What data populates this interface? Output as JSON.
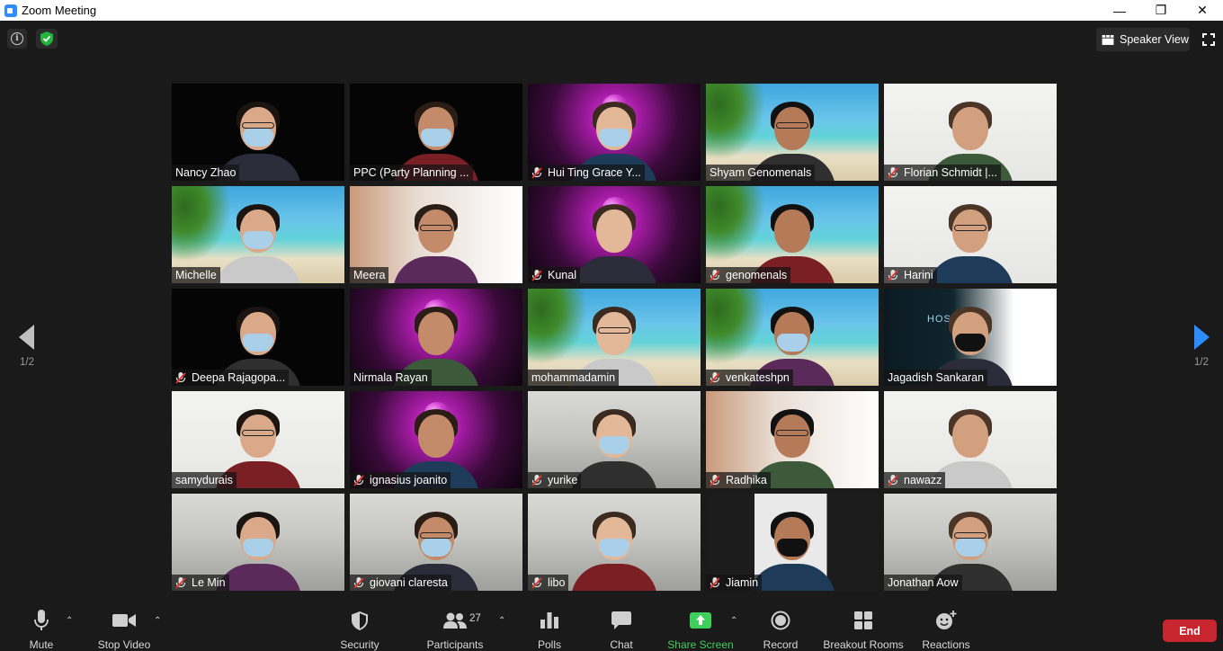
{
  "window": {
    "title": "Zoom Meeting",
    "controls": [
      "—",
      "❐",
      "✕"
    ]
  },
  "top_bar": {
    "info_icon": "i",
    "speaker_view_label": "Speaker View"
  },
  "nav": {
    "left_page": "1/2",
    "right_page": "1/2"
  },
  "participants": [
    {
      "name": "Nancy Zhao",
      "muted": false,
      "bg": "black",
      "mask": true,
      "active": false
    },
    {
      "name": "PPC (Party Planning ...",
      "muted": false,
      "bg": "black",
      "mask": true,
      "active": true
    },
    {
      "name": "Hui Ting Grace Y...",
      "muted": true,
      "bg": "party",
      "mask": true,
      "active": false
    },
    {
      "name": "Shyam Genomenals",
      "muted": false,
      "bg": "beach",
      "mask": false,
      "active": false
    },
    {
      "name": "Florian Schmidt |...",
      "muted": true,
      "bg": "white",
      "mask": false,
      "active": false
    },
    {
      "name": "Michelle",
      "muted": false,
      "bg": "beach",
      "mask": true,
      "active": false
    },
    {
      "name": "Meera",
      "muted": false,
      "bg": "room",
      "mask": false,
      "active": false
    },
    {
      "name": "Kunal",
      "muted": true,
      "bg": "party",
      "mask": false,
      "active": false
    },
    {
      "name": "genomenals",
      "muted": true,
      "bg": "beach",
      "mask": false,
      "active": false
    },
    {
      "name": "Harini",
      "muted": true,
      "bg": "white",
      "mask": false,
      "active": false
    },
    {
      "name": "Deepa Rajagopa...",
      "muted": true,
      "bg": "black",
      "mask": true,
      "active": false
    },
    {
      "name": "Nirmala Rayan",
      "muted": false,
      "bg": "party",
      "mask": false,
      "active": false
    },
    {
      "name": "mohammadamin",
      "muted": false,
      "bg": "beach",
      "mask": false,
      "active": false
    },
    {
      "name": "venkateshpn",
      "muted": true,
      "bg": "beach",
      "mask": true,
      "active": false
    },
    {
      "name": "Jagadish Sankaran",
      "muted": false,
      "bg": "host",
      "mask": true,
      "active": false
    },
    {
      "name": "samydurais",
      "muted": false,
      "bg": "white",
      "mask": false,
      "active": false
    },
    {
      "name": "ignasius joanito",
      "muted": true,
      "bg": "party",
      "mask": false,
      "active": false
    },
    {
      "name": "yurike",
      "muted": true,
      "bg": "office",
      "mask": true,
      "active": false
    },
    {
      "name": "Radhika",
      "muted": true,
      "bg": "room",
      "mask": false,
      "active": false
    },
    {
      "name": "nawazz",
      "muted": true,
      "bg": "white",
      "mask": false,
      "active": false
    },
    {
      "name": "Le Min",
      "muted": true,
      "bg": "office",
      "mask": true,
      "active": false
    },
    {
      "name": "giovani claresta",
      "muted": true,
      "bg": "office",
      "mask": true,
      "active": false
    },
    {
      "name": "libo",
      "muted": true,
      "bg": "office",
      "mask": true,
      "active": false
    },
    {
      "name": "Jiamin",
      "muted": true,
      "bg": "dark-split",
      "mask": true,
      "active": false
    },
    {
      "name": "Jonathan Aow",
      "muted": false,
      "bg": "office",
      "mask": true,
      "active": false
    }
  ],
  "host_logo_text": "HOST",
  "toolbar": {
    "mute": "Mute",
    "stop_video": "Stop Video",
    "security": "Security",
    "participants": "Participants",
    "participant_count": "27",
    "polls": "Polls",
    "chat": "Chat",
    "share_screen": "Share Screen",
    "record": "Record",
    "breakout_rooms": "Breakout Rooms",
    "reactions": "Reactions",
    "end": "End"
  },
  "colors": {
    "share_green": "#3ecf5a",
    "end_red": "#c8262f",
    "active_speaker_border": "#c9d86a",
    "nav_arrow_active": "#2d8cff"
  }
}
